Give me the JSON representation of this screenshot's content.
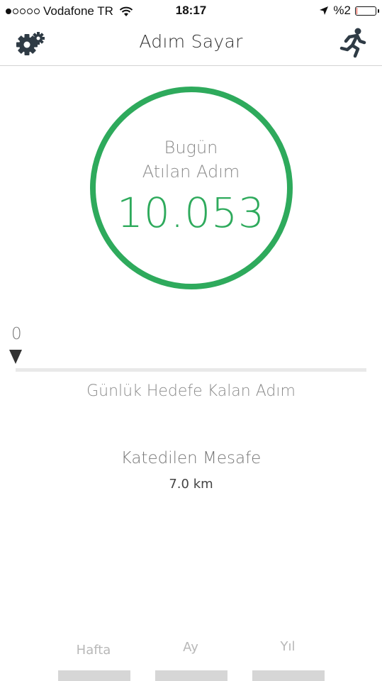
{
  "status_bar": {
    "carrier": "Vodafone TR",
    "time": "18:17",
    "battery": "%2",
    "battery_level": 0.02
  },
  "nav": {
    "title": "Adım Sayar"
  },
  "today": {
    "label_line1": "Bugün",
    "label_line2": "Atılan Adım",
    "steps": "10.053"
  },
  "goal": {
    "remaining": "0",
    "label": "Günlük Hedefe Kalan Adım"
  },
  "distance": {
    "label": "Katedilen Mesafe",
    "value": "7.0 km"
  },
  "periods": {
    "week": "Hafta",
    "month": "Ay",
    "year": "Yıl"
  },
  "colors": {
    "accent": "#2eaa5c",
    "battery_low": "#dd3322"
  }
}
